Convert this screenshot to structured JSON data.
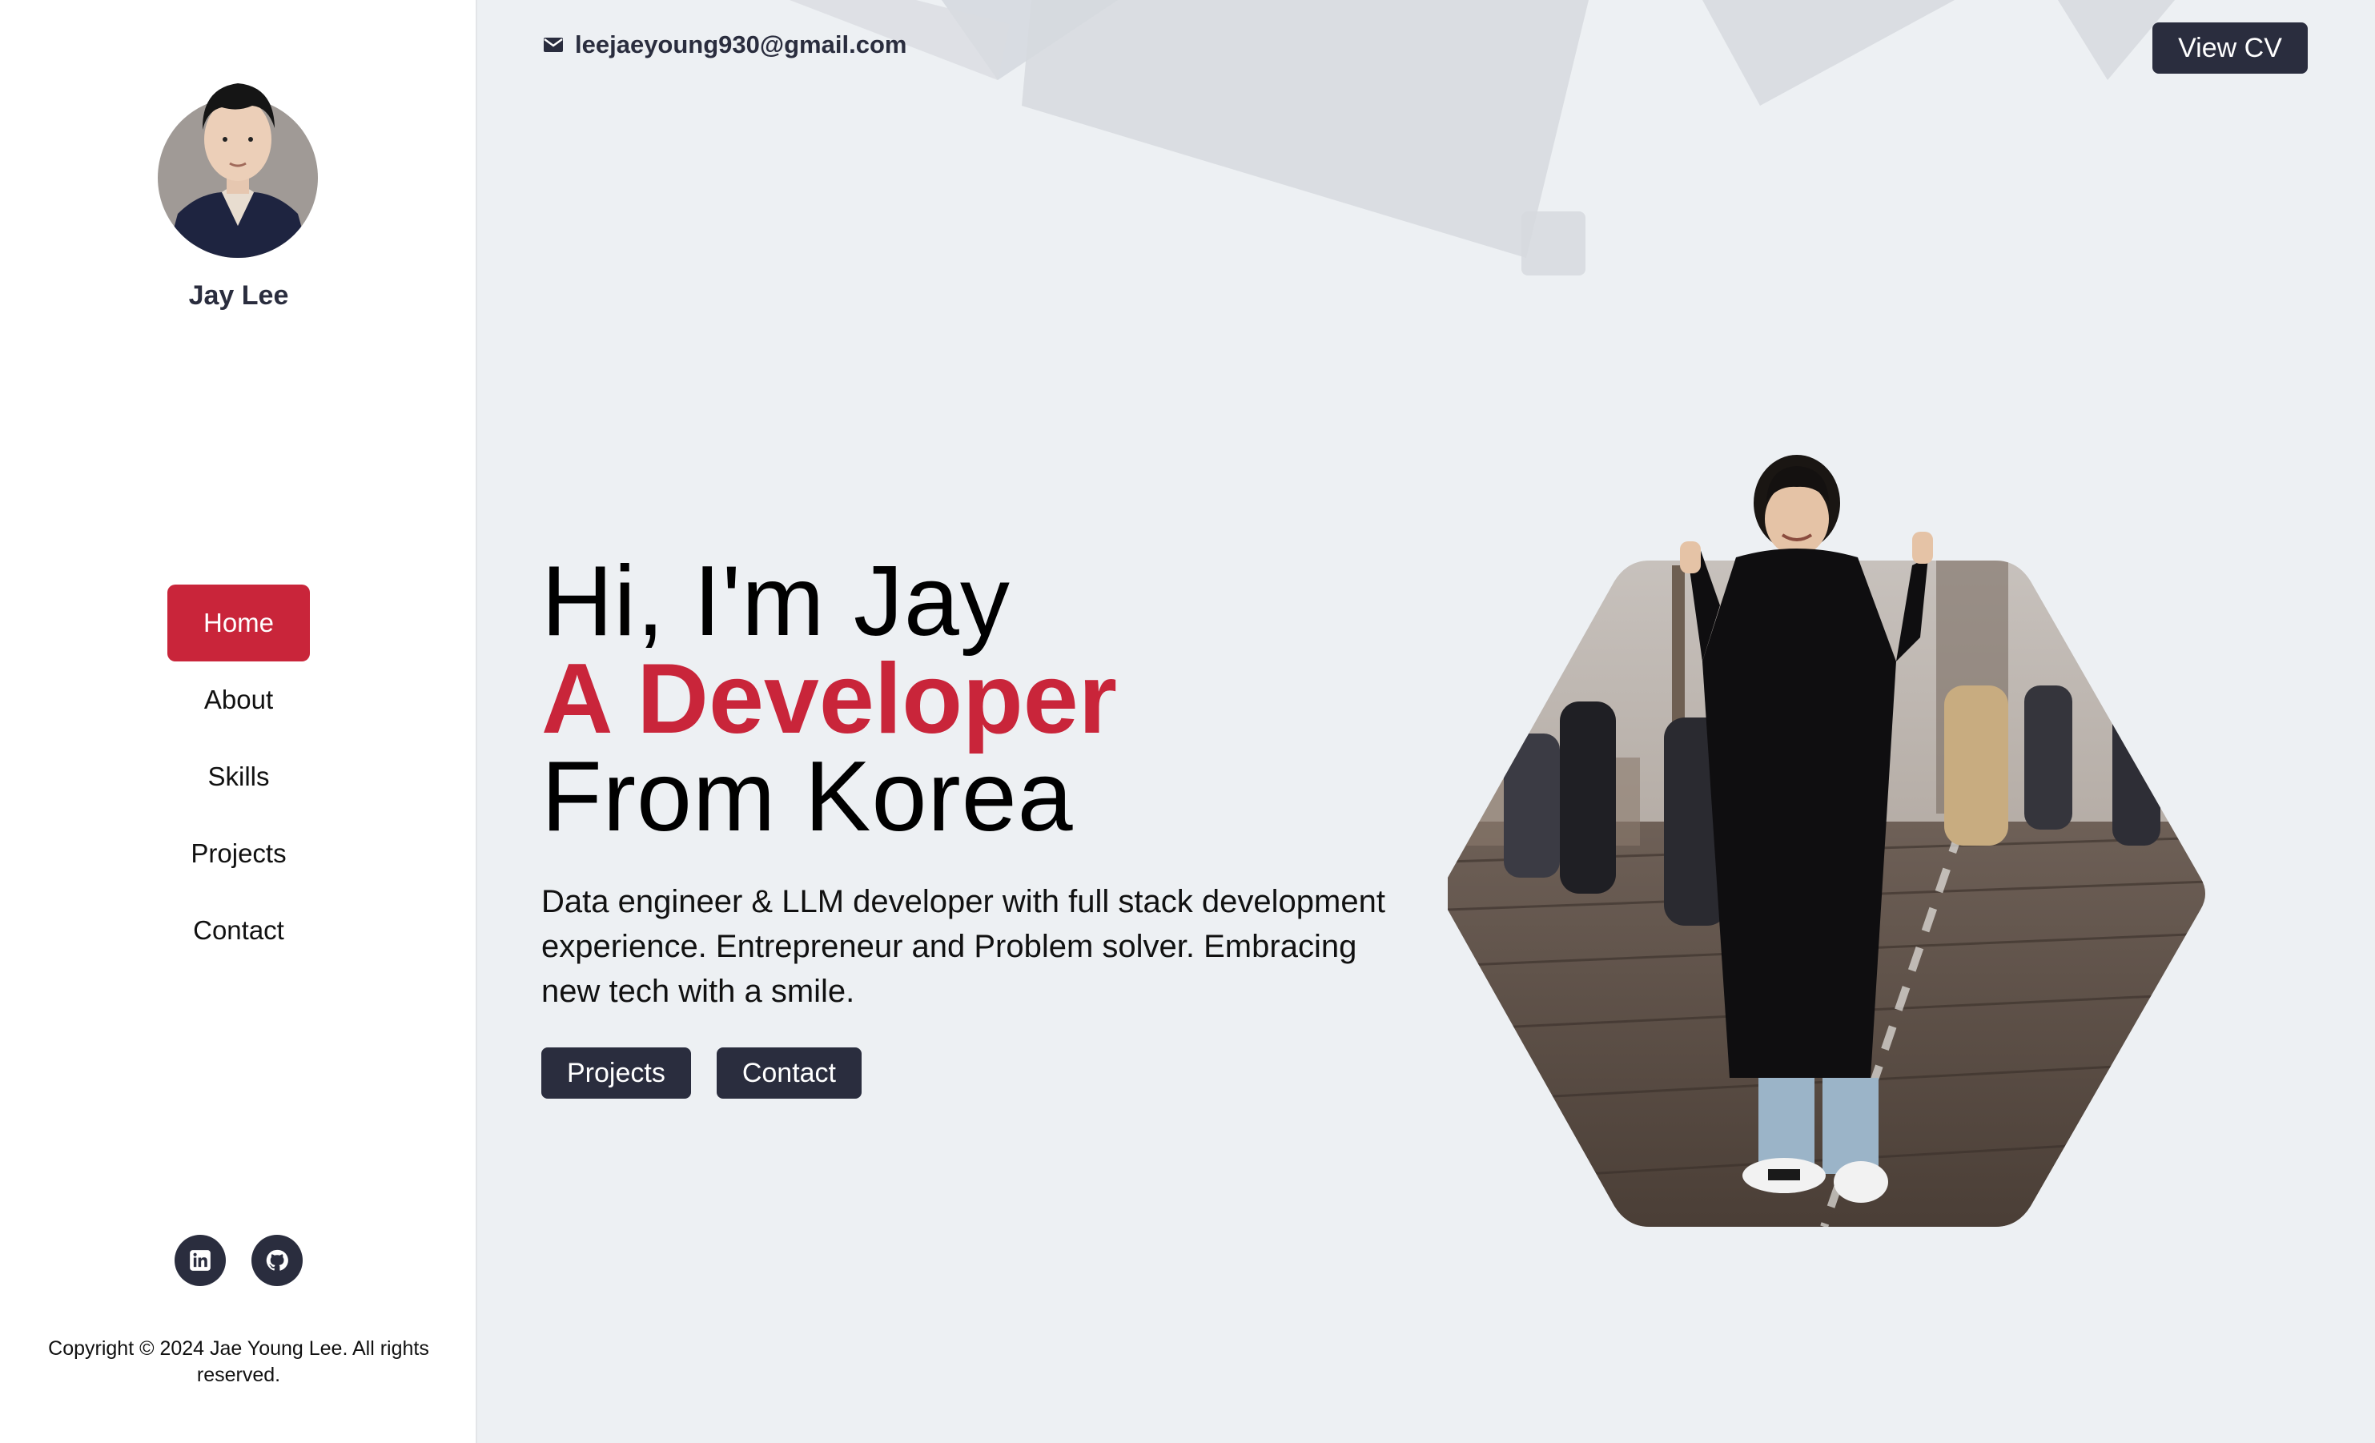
{
  "sidebar": {
    "name": "Jay Lee",
    "nav": [
      "Home",
      "About",
      "Skills",
      "Projects",
      "Contact"
    ],
    "active": "Home",
    "social": [
      "linkedin-icon",
      "github-icon"
    ],
    "copyright": "Copyright © 2024 Jae Young Lee. All rights reserved."
  },
  "header": {
    "email": "leejaeyoung930@gmail.com",
    "cv_label": "View CV"
  },
  "hero": {
    "line1": "Hi, I'm Jay",
    "line2": "A Developer",
    "line3": "From Korea",
    "description": "Data engineer & LLM developer with full stack development experience. Entrepreneur and Problem solver. Embracing new tech with a smile.",
    "projects_label": "Projects",
    "contact_label": "Contact"
  },
  "colors": {
    "accent": "#c9253a",
    "dark": "#2a2d3e",
    "background": "#edf0f3"
  }
}
